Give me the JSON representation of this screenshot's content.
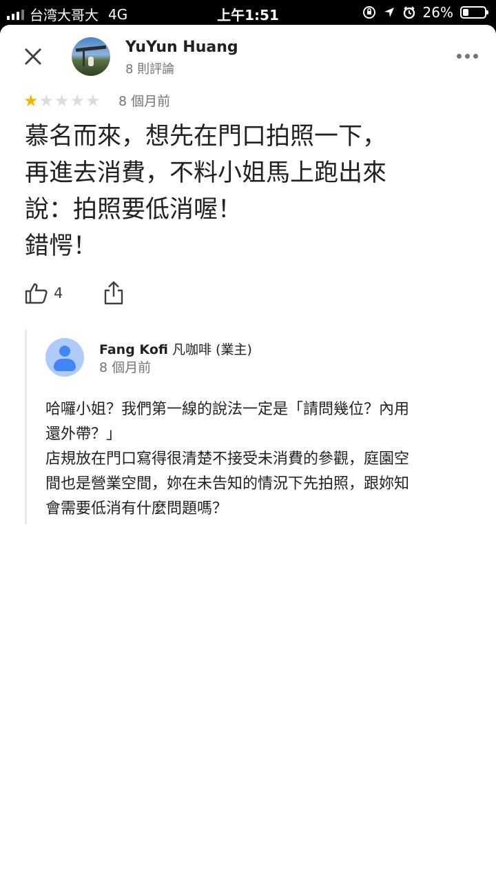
{
  "status_bar": {
    "carrier": "台湾大哥大",
    "network": "4G",
    "time": "上午1:51",
    "battery": "26%",
    "battery_level": 0.26
  },
  "reviewer": {
    "name": "YuYun Huang",
    "review_count": "8 則評論"
  },
  "review": {
    "rating": 1,
    "max_rating": 5,
    "time": "8 個月前",
    "text": "慕名而來，想先在門口拍照一下，\n再進去消費，不料小姐馬上跑出來\n說：拍照要低消喔！\n錯愕！",
    "likes": "4"
  },
  "owner_reply": {
    "name": "Fang Kofi",
    "name_suffix": " 凡咖啡 (業主)",
    "time": "8 個月前",
    "text": "哈囉小姐？我們第一線的說法一定是「請問幾位？內用\n還外帶？」\n店規放在門口寫得很清楚不接受未消費的參觀，庭園空\n間也是營業空間，妳在未告知的情況下先拍照，跟妳知\n會需要低消有什麼問題嗎？"
  },
  "icons": {
    "close": "close-icon",
    "more": "more-vert-icon",
    "like": "thumb-up-icon",
    "share": "share-icon"
  },
  "colors": {
    "star_filled": "#f5b400",
    "star_empty": "#dadce0",
    "owner_avatar_bg": "#aecbfa",
    "owner_avatar_fg": "#4285f4"
  }
}
